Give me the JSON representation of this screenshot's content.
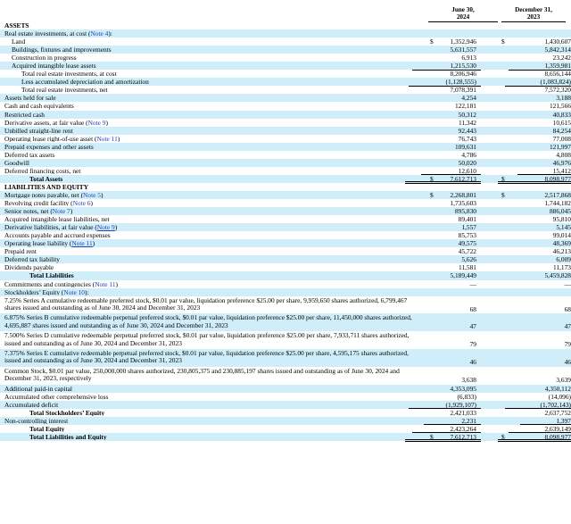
{
  "header": {
    "col1_line1": "June 30,",
    "col1_line2": "2024",
    "col2_line1": "December 31,",
    "col2_line2": "2023"
  },
  "rows": [
    {
      "label": "ASSETS",
      "kind": "sec",
      "v1": "",
      "v2": ""
    },
    {
      "label": "Real estate investments, at cost (",
      "link": "Note 4",
      "tail": "):",
      "kind": "i0",
      "v1": "",
      "v2": ""
    },
    {
      "label": "Land",
      "kind": "i1",
      "d1": "$",
      "v1": "1,352,946",
      "d2": "$",
      "v2": "1,430,607"
    },
    {
      "label": "Buildings, fixtures and improvements",
      "kind": "i1",
      "v1": "5,631,557",
      "v2": "5,842,314"
    },
    {
      "label": "Construction in progress",
      "kind": "i1",
      "v1": "6,913",
      "v2": "23,242"
    },
    {
      "label": "Acquired intangible lease assets",
      "kind": "i1",
      "v1": "1,215,530",
      "v2": "1,359,981",
      "ul": true
    },
    {
      "label": "Total real estate investments, at cost",
      "kind": "i2",
      "v1": "8,206,946",
      "v2": "8,656,144"
    },
    {
      "label": "Less accumulated depreciation and amortization",
      "kind": "i2",
      "v1": "(1,128,555)",
      "v2": "(1,083,824)",
      "ul": true
    },
    {
      "label": "Total real estate investments, net",
      "kind": "i2",
      "v1": "7,078,391",
      "v2": "7,572,320"
    },
    {
      "label": "Assets held for sale",
      "kind": "i0",
      "v1": "4,254",
      "v2": "3,188"
    },
    {
      "label": "Cash and cash equivalents",
      "kind": "i0",
      "v1": "122,181",
      "v2": "121,566"
    },
    {
      "label": "Restricted cash",
      "kind": "i0",
      "v1": "50,312",
      "v2": "40,833"
    },
    {
      "label": "Derivative assets, at fair value (",
      "link": "Note 9",
      "tail": ")",
      "kind": "i0",
      "v1": "11,342",
      "v2": "10,615"
    },
    {
      "label": "Unbilled straight-line rent",
      "kind": "i0",
      "v1": "92,443",
      "v2": "84,254"
    },
    {
      "label": "Operating lease right-of-use asset (",
      "link": "Note 11",
      "tail": ")",
      "kind": "i0",
      "v1": "76,743",
      "v2": "77,008"
    },
    {
      "label": "Prepaid expenses and other assets",
      "kind": "i0",
      "v1": "109,631",
      "v2": "121,997"
    },
    {
      "label": "Deferred tax assets",
      "kind": "i0",
      "v1": "4,786",
      "v2": "4,808"
    },
    {
      "label": "Goodwill",
      "kind": "i0",
      "v1": "50,020",
      "v2": "46,976"
    },
    {
      "label": "Deferred financing costs, net",
      "kind": "i0",
      "v1": "12,610",
      "v2": "15,412",
      "ul": true
    },
    {
      "label": "Total Assets",
      "kind": "i3b",
      "d1": "$",
      "v1": "7,612,713",
      "d2": "$",
      "v2": "8,098,977",
      "dul": true
    },
    {
      "label": "LIABILITIES AND EQUITY",
      "kind": "sec",
      "v1": "",
      "v2": ""
    },
    {
      "label": "Mortgage notes payable, net (",
      "link": "Note 5",
      "tail": ")",
      "kind": "i0",
      "d1": "$",
      "v1": "2,268,801",
      "d2": "$",
      "v2": "2,517,868"
    },
    {
      "label": "Revolving credit facility (",
      "link": "Note 6",
      "tail": ")",
      "kind": "i0",
      "v1": "1,735,603",
      "v2": "1,744,182"
    },
    {
      "label": "Senior notes, net (",
      "link": "Note 7",
      "tail": ")",
      "kind": "i0",
      "v1": "895,830",
      "v2": "886,045"
    },
    {
      "label": "Acquired intangible lease liabilities, net",
      "kind": "i0",
      "v1": "89,401",
      "v2": "95,810"
    },
    {
      "label": "Derivative liabilities, at fair value (",
      "link": "Note 9",
      "tail": ")",
      "kind": "i0",
      "v1": "1,557",
      "v2": "5,145"
    },
    {
      "label": "Accounts payable and accrued expenses",
      "kind": "i0",
      "v1": "85,753",
      "v2": "99,014"
    },
    {
      "label": "Operating lease liability (",
      "link": "Note 11",
      "tail": ")",
      "kind": "i0",
      "v1": "49,575",
      "v2": "48,369"
    },
    {
      "label": "Prepaid rent",
      "kind": "i0",
      "v1": "45,722",
      "v2": "46,213"
    },
    {
      "label": "Deferred tax liability",
      "kind": "i0",
      "v1": "5,626",
      "v2": "6,009"
    },
    {
      "label": "Dividends payable",
      "kind": "i0",
      "v1": "11,581",
      "v2": "11,173",
      "ul": true
    },
    {
      "label": "Total Liabilities",
      "kind": "i3b",
      "v1": "5,189,449",
      "v2": "5,459,828"
    },
    {
      "label": "Commitments and contingencies (",
      "link": "Note 11",
      "tail": ")",
      "kind": "i0",
      "v1": "—",
      "v2": "—"
    },
    {
      "label": "Stockholders’ Equity (",
      "link": "Note 10",
      "tail": "):",
      "kind": "i0",
      "v1": "",
      "v2": ""
    },
    {
      "label": "7.25% Series A cumulative redeemable preferred stock, $0.01 par value, liquidation preference $25.00 per share, 9,959,650 shares authorized, 6,799,467 shares issued and outstanding as of June 30, 2024 and December 31, 2023",
      "kind": "i0",
      "tall": true,
      "v1": "68",
      "v2": "68"
    },
    {
      "label": "6.875% Series B cumulative redeemable perpetual preferred stock, $0.01 par value, liquidation preference $25.00 per share, 11,450,000 shares authorized, 4,695,887 shares issued and outstanding as of June 30, 2024 and December 31, 2023",
      "kind": "i0",
      "tall": true,
      "v1": "47",
      "v2": "47"
    },
    {
      "label": "7.500% Series D cumulative redeemable perpetual preferred stock, $0.01 par value, liquidation preference $25.00 per share, 7,933,711 shares authorized, issued and outstanding as of June 30, 2024 and December 31, 2023",
      "kind": "i0",
      "tall": true,
      "v1": "79",
      "v2": "79"
    },
    {
      "label": "7.375% Series E cumulative redeemable perpetual preferred stock, $0.01 par value, liquidation preference $25.00 per share, 4,595,175 shares authorized, issued and outstanding as of June 30, 2024 and December 31, 2023",
      "kind": "i0",
      "tall": true,
      "v1": "46",
      "v2": "46"
    },
    {
      "label": "Common Stock, $0.01 par value, 250,000,000 shares authorized, 230,805,375 and 230,885,197 shares issued and outstanding as of June 30, 2024 and December 31, 2023, respectively",
      "kind": "i0",
      "tall": true,
      "v1": "3,638",
      "v2": "3,639"
    },
    {
      "label": "Additional paid-in capital",
      "kind": "i0",
      "v1": "4,353,095",
      "v2": "4,350,112"
    },
    {
      "label": "Accumulated other comprehensive loss",
      "kind": "i0",
      "v1": "(6,833)",
      "v2": "(14,096)"
    },
    {
      "label": "Accumulated deficit",
      "kind": "i0",
      "v1": "(1,929,107)",
      "v2": "(1,702,143)",
      "ul": true
    },
    {
      "label": "Total Stockholders’ Equity",
      "kind": "i3b",
      "v1": "2,421,033",
      "v2": "2,637,752"
    },
    {
      "label": "Non-controlling interest",
      "kind": "i0",
      "v1": "2,231",
      "v2": "1,397",
      "ul": true
    },
    {
      "label": "Total Equity",
      "kind": "i3b",
      "v1": "2,423,264",
      "v2": "2,639,149",
      "ul": true
    },
    {
      "label": "Total Liabilities and Equity",
      "kind": "i3b",
      "d1": "$",
      "v1": "7,612,713",
      "d2": "$",
      "v2": "8,098,977",
      "dul": true
    }
  ]
}
